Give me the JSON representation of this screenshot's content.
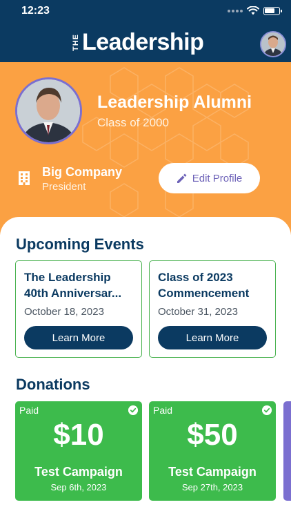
{
  "status_bar": {
    "time": "12:23"
  },
  "header": {
    "logo_prefix": "THE",
    "logo_text": "Leadership"
  },
  "profile": {
    "name": "Leadership Alumni",
    "class_of": "Class of 2000",
    "company": "Big Company",
    "role": "President",
    "edit_label": "Edit Profile"
  },
  "events": {
    "title": "Upcoming Events",
    "items": [
      {
        "title_line1": "The Leadership",
        "title_line2": "40th Anniversar...",
        "date": "October 18, 2023",
        "button": "Learn More"
      },
      {
        "title_line1": "Class of 2023",
        "title_line2": "Commencement",
        "date": "October 31, 2023",
        "button": "Learn More"
      }
    ]
  },
  "donations": {
    "title": "Donations",
    "items": [
      {
        "status": "Paid",
        "amount": "$10",
        "campaign": "Test Campaign",
        "date": "Sep 6th, 2023"
      },
      {
        "status": "Paid",
        "amount": "$50",
        "campaign": "Test Campaign",
        "date": "Sep 27th, 2023"
      }
    ]
  },
  "colors": {
    "navy": "#0b3a61",
    "orange": "#fba143",
    "green": "#3dbb4c",
    "purple": "#7b6fd0"
  },
  "icons": [
    "wifi-icon",
    "battery-icon",
    "building-icon",
    "pencil-icon",
    "check-icon"
  ]
}
